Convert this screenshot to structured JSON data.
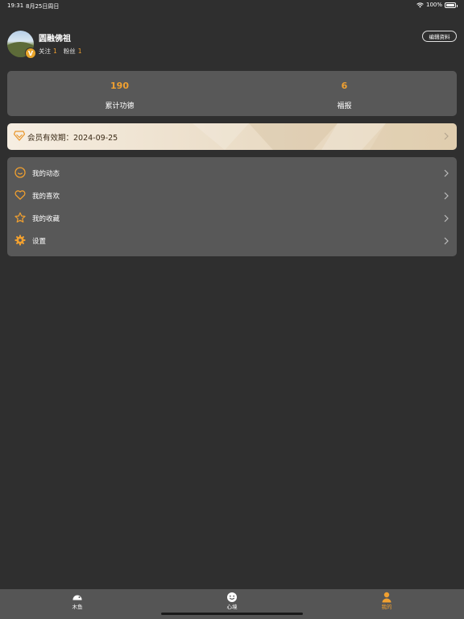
{
  "status_bar": {
    "time": "19:31",
    "date": "8月25日周日",
    "battery": "100%"
  },
  "profile": {
    "name": "圆融佛祖",
    "vip_badge": "V",
    "following_label": "关注",
    "following_count": "1",
    "followers_label": "粉丝",
    "followers_count": "1",
    "edit_button": "编辑资料"
  },
  "stats": [
    {
      "value": "190",
      "label": "累计功德"
    },
    {
      "value": "6",
      "label": "福报"
    }
  ],
  "membership": {
    "text": "会员有效期：2024-09-25"
  },
  "menu": [
    {
      "label": "我的动态",
      "icon": "smile-circle-icon"
    },
    {
      "label": "我的喜欢",
      "icon": "heart-icon"
    },
    {
      "label": "我的收藏",
      "icon": "star-icon"
    },
    {
      "label": "设置",
      "icon": "gear-icon"
    }
  ],
  "tabs": [
    {
      "label": "木鱼",
      "icon": "wooden-fish-icon"
    },
    {
      "label": "心境",
      "icon": "mood-icon"
    },
    {
      "label": "我的",
      "icon": "person-icon",
      "active": true
    }
  ],
  "colors": {
    "accent": "#f0a030",
    "background": "#2f2f2f",
    "card": "#585858"
  }
}
